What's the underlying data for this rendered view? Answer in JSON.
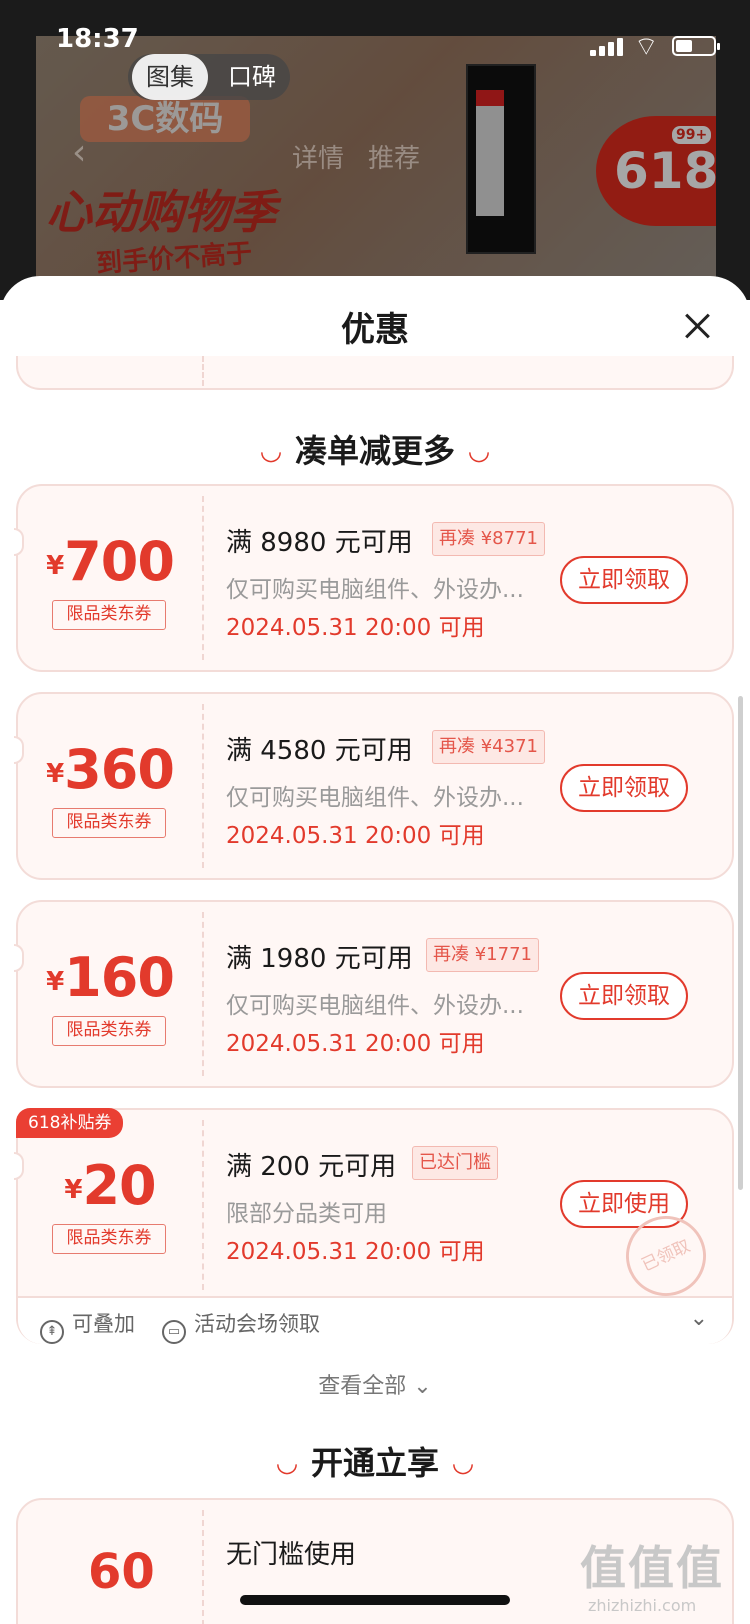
{
  "status_bar": {
    "time": "18:37"
  },
  "background_page": {
    "tabs": [
      "图集",
      "口碑"
    ],
    "nav": [
      "详情",
      "推荐"
    ],
    "poster_texts": [
      "3C数码",
      "心动购物季",
      "到手价不高于"
    ],
    "badge": "618",
    "badge_count": "99+"
  },
  "sheet": {
    "title": "优惠",
    "sections": {
      "more": "凑单减更多",
      "open": "开通立享"
    },
    "coupons": [
      {
        "currency": "¥",
        "amount": "700",
        "scope": "限品类东券",
        "condition": "满 8980 元可用",
        "tag": "再凑 ¥8771",
        "desc": "仅可购买电脑组件、外设办...",
        "date": "2024.05.31 20:00 可用",
        "action": "立即领取"
      },
      {
        "currency": "¥",
        "amount": "360",
        "scope": "限品类东券",
        "condition": "满 4580 元可用",
        "tag": "再凑 ¥4371",
        "desc": "仅可购买电脑组件、外设办...",
        "date": "2024.05.31 20:00 可用",
        "action": "立即领取"
      },
      {
        "currency": "¥",
        "amount": "160",
        "scope": "限品类东券",
        "condition": "满 1980 元可用",
        "tag": "再凑 ¥1771",
        "desc": "仅可购买电脑组件、外设办...",
        "date": "2024.05.31 20:00 可用",
        "action": "立即领取"
      },
      {
        "currency": "¥",
        "amount": "20",
        "scope": "限品类东券",
        "condition": "满 200 元可用",
        "tag": "已达门槛",
        "desc": "限部分品类可用",
        "date": "2024.05.31 20:00 可用",
        "action": "立即使用",
        "badge": "618补贴券",
        "stamp": "已领取"
      }
    ],
    "coupon_footer": {
      "stackable": "可叠加",
      "source": "活动会场领取"
    },
    "view_all": "查看全部",
    "bottom_coupon": {
      "amount": "60",
      "condition": "无门槛使用"
    }
  },
  "watermark": {
    "text": "zhizhizhi.com",
    "mark": "值值值"
  },
  "colors": {
    "accent": "#e23a2c",
    "coupon_bg": "#fff7f5",
    "coupon_border": "#f3dcd8"
  }
}
